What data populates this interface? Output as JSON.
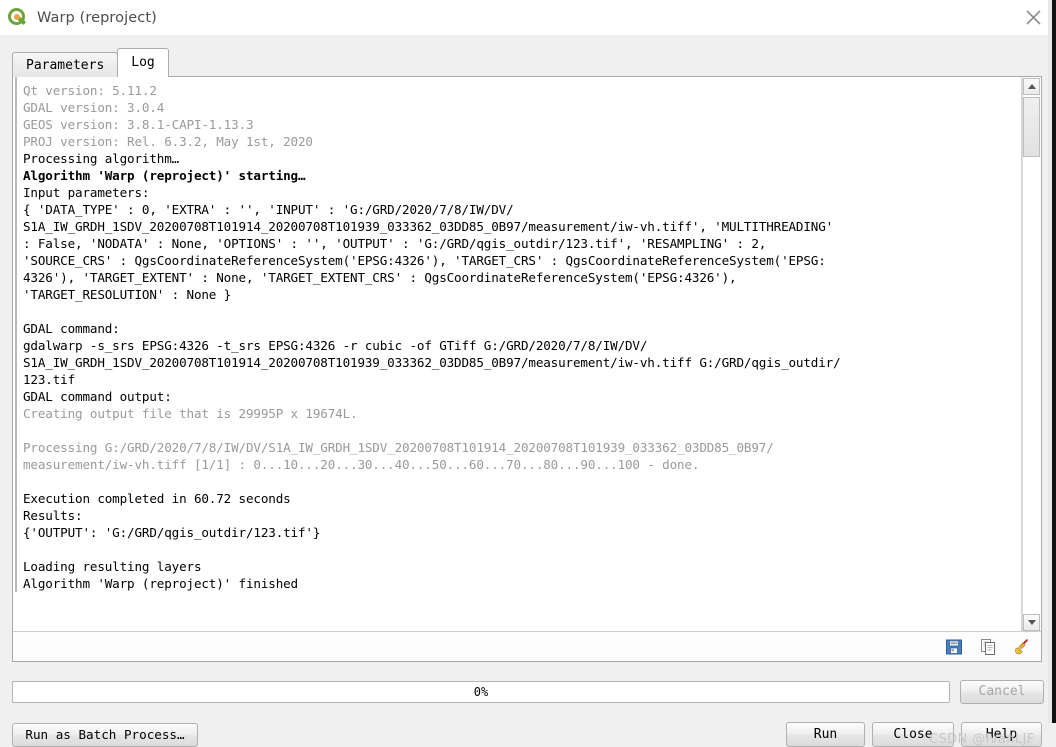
{
  "window": {
    "title": "Warp (reproject)",
    "app_icon": "qgis-logo-icon",
    "close_icon": "close-icon"
  },
  "tabs": [
    {
      "label": "Parameters",
      "active": false
    },
    {
      "label": "Log",
      "active": true
    }
  ],
  "log": {
    "lines": [
      {
        "text": "Qt version: 5.11.2",
        "style": "gray"
      },
      {
        "text": "GDAL version: 3.0.4",
        "style": "gray"
      },
      {
        "text": "GEOS version: 3.8.1-CAPI-1.13.3",
        "style": "gray"
      },
      {
        "text": "PROJ version: Rel. 6.3.2, May 1st, 2020",
        "style": "gray"
      },
      {
        "text": "Processing algorithm…",
        "style": "normal"
      },
      {
        "text": "Algorithm 'Warp (reproject)' starting…",
        "style": "bold"
      },
      {
        "text": "Input parameters:",
        "style": "normal"
      },
      {
        "text": "{ 'DATA_TYPE' : 0, 'EXTRA' : '', 'INPUT' : 'G:/GRD/2020/7/8/IW/DV/",
        "style": "normal"
      },
      {
        "text": "S1A_IW_GRDH_1SDV_20200708T101914_20200708T101939_033362_03DD85_0B97/measurement/iw-vh.tiff', 'MULTITHREADING'",
        "style": "normal"
      },
      {
        "text": ": False, 'NODATA' : None, 'OPTIONS' : '', 'OUTPUT' : 'G:/GRD/qgis_outdir/123.tif', 'RESAMPLING' : 2,",
        "style": "normal"
      },
      {
        "text": "'SOURCE_CRS' : QgsCoordinateReferenceSystem('EPSG:4326'), 'TARGET_CRS' : QgsCoordinateReferenceSystem('EPSG:",
        "style": "normal"
      },
      {
        "text": "4326'), 'TARGET_EXTENT' : None, 'TARGET_EXTENT_CRS' : QgsCoordinateReferenceSystem('EPSG:4326'),",
        "style": "normal"
      },
      {
        "text": "'TARGET_RESOLUTION' : None }",
        "style": "normal"
      },
      {
        "text": "",
        "style": "blank"
      },
      {
        "text": "GDAL command:",
        "style": "normal"
      },
      {
        "text": "gdalwarp -s_srs EPSG:4326 -t_srs EPSG:4326 -r cubic -of GTiff G:/GRD/2020/7/8/IW/DV/",
        "style": "normal"
      },
      {
        "text": "S1A_IW_GRDH_1SDV_20200708T101914_20200708T101939_033362_03DD85_0B97/measurement/iw-vh.tiff G:/GRD/qgis_outdir/",
        "style": "normal"
      },
      {
        "text": "123.tif",
        "style": "normal"
      },
      {
        "text": "GDAL command output:",
        "style": "normal"
      },
      {
        "text": "Creating output file that is 29995P x 19674L.",
        "style": "gray"
      },
      {
        "text": "",
        "style": "blank"
      },
      {
        "text": "Processing G:/GRD/2020/7/8/IW/DV/S1A_IW_GRDH_1SDV_20200708T101914_20200708T101939_033362_03DD85_0B97/",
        "style": "gray"
      },
      {
        "text": "measurement/iw-vh.tiff [1/1] : 0...10...20...30...40...50...60...70...80...90...100 - done.",
        "style": "gray"
      },
      {
        "text": "",
        "style": "blank"
      },
      {
        "text": "Execution completed in 60.72 seconds",
        "style": "normal"
      },
      {
        "text": "Results:",
        "style": "normal"
      },
      {
        "text": "{'OUTPUT': 'G:/GRD/qgis_outdir/123.tif'}",
        "style": "normal"
      },
      {
        "text": "",
        "style": "blank"
      },
      {
        "text": "Loading resulting layers",
        "style": "normal"
      },
      {
        "text": "Algorithm 'Warp (reproject)' finished",
        "style": "normal"
      }
    ],
    "toolbar": [
      {
        "icon": "save-icon"
      },
      {
        "icon": "copy-icon"
      },
      {
        "icon": "clear-broom-icon"
      }
    ],
    "scrollbar": {
      "up_icon": "scroll-up-arrow-icon",
      "down_icon": "scroll-down-arrow-icon"
    }
  },
  "progress": {
    "percent_label": "0%",
    "value": 0
  },
  "buttons": {
    "cancel": "Cancel",
    "batch": "Run as Batch Process…",
    "run": "Run",
    "close": "Close",
    "help": "Help"
  },
  "watermark": "CSDN @IvanLJF",
  "colors": {
    "accent_green": "#6ba43a",
    "accent_orange": "#f0a03c",
    "dialog_bg": "#f0f0f0",
    "log_bg": "#ffffff",
    "muted_text": "#9a9a9a"
  }
}
